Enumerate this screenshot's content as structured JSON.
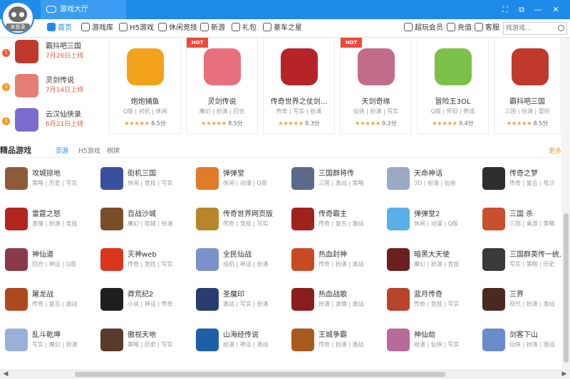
{
  "titlebar": {
    "avatar_badge": "未登录",
    "hall_tab": "游戏大厅",
    "controls": [
      "⛶",
      "⧉",
      "—",
      "✕"
    ]
  },
  "nav": {
    "items": [
      {
        "label": "首页",
        "icon": "home-icon",
        "active": true
      },
      {
        "label": "游戏库",
        "icon": "gamepad-icon",
        "active": false
      },
      {
        "label": "H5游戏",
        "icon": "h5-icon",
        "active": false
      },
      {
        "label": "休闲竞技",
        "icon": "casual-icon",
        "active": false
      },
      {
        "label": "新游",
        "icon": "new-icon",
        "active": false
      },
      {
        "label": "礼包",
        "icon": "gift-icon",
        "active": false
      },
      {
        "label": "豪车之星",
        "icon": "car-icon",
        "active": false
      }
    ],
    "vip": "超玩会员",
    "recharge": "充值",
    "service": "客服",
    "search_placeholder": "找游戏..."
  },
  "new_games": [
    {
      "rank": "1",
      "name": "霸抖吧三国",
      "date": "7月26日上线",
      "color": "#c0392b"
    },
    {
      "rank": "2",
      "name": "灵剑传说",
      "date": "7月14日上线",
      "color": "#e67e73"
    },
    {
      "rank": "3",
      "name": "云汉仙侠录",
      "date": "6月21日上线",
      "color": "#7a6bd1"
    }
  ],
  "featured": [
    {
      "name": "炮炮捕鱼",
      "tags": "Q版 | 对抗 | 休闲",
      "stars": "★★★★★",
      "score": "8.5分",
      "hot": false,
      "color": "#f2a21a"
    },
    {
      "name": "灵剑传说",
      "tags": "魔幻 | 扮演 | 回合",
      "stars": "★★★★★",
      "score": "8.5分",
      "hot": true,
      "color": "#e86f7c"
    },
    {
      "name": "传奇世界之仗剑...",
      "tags": "传奇 | 写实 | 扮演",
      "stars": "★★★★★",
      "score": "9.3分",
      "hot": false,
      "color": "#b6242a"
    },
    {
      "name": "天剑奇缘",
      "tags": "仙侠 | 扮演 | 写实",
      "stars": "★★★★★",
      "score": "9.2分",
      "hot": true,
      "color": "#c06c8a"
    },
    {
      "name": "冒险王3OL",
      "tags": "Q版 | 怀旧 | 养成",
      "stars": "★★★★★",
      "score": "9.4分",
      "hot": false,
      "color": "#7cc04a"
    },
    {
      "name": "霸抖吧三国",
      "tags": "三国 | 扮演 | 冒险",
      "stars": "★★★★★",
      "score": "8.5分",
      "hot": false,
      "color": "#c0392b"
    }
  ],
  "section": {
    "title": "精品游戏",
    "tabs": [
      "页游",
      "H5游戏",
      "棋牌"
    ],
    "more": "更多"
  },
  "games": [
    [
      {
        "name": "攻城掠地",
        "tags": "策略 | 历史 | 写实",
        "color": "#8e5a3a"
      },
      {
        "name": "街机三国",
        "tags": "休闲 | 竞技 | 写实",
        "color": "#3a4f9e"
      },
      {
        "name": "弹弹堂",
        "tags": "休闲 | 动漫 | Q版",
        "color": "#e07b2a"
      },
      {
        "name": "三国群将传",
        "tags": "三国 | 激战 | 策略",
        "color": "#5b6a8a"
      },
      {
        "name": "天命神话",
        "tags": "3D | 扮演 | 仙侠",
        "color": "#9aa9c4"
      },
      {
        "name": "传奇之梦",
        "tags": "传奇 | 复古 | 攻沙",
        "color": "#2e2e2e"
      }
    ],
    [
      {
        "name": "雷霆之怒",
        "tags": "激情 | 扮演 | 竞技",
        "color": "#b3261e"
      },
      {
        "name": "百战沙城",
        "tags": "魔幻 | 攻城 | 扮演",
        "color": "#7a4d2a"
      },
      {
        "name": "传奇世界网页版",
        "tags": "传奇 | 竞技 | 写实",
        "color": "#b8862a"
      },
      {
        "name": "传奇霸主",
        "tags": "传奇 | 复古 | 激战",
        "color": "#a0221e"
      },
      {
        "name": "弹弹堂2",
        "tags": "休闲 | 动漫 | Q版",
        "color": "#58b0e6"
      },
      {
        "name": "三国 杀",
        "tags": "三国 | 桌游 | 策略",
        "color": "#c9502e"
      }
    ],
    [
      {
        "name": "神仙道",
        "tags": "回合 | 神话 | Q版",
        "color": "#8a3a4a"
      },
      {
        "name": "灭神web",
        "tags": "传奇 | 竞技 | 写实",
        "color": "#d8371e"
      },
      {
        "name": "全民仙战",
        "tags": "挂机 | 神话 | 扮演",
        "color": "#7a92c9"
      },
      {
        "name": "热血封神",
        "tags": "传奇 | 扮演 | 激战",
        "color": "#c84a22"
      },
      {
        "name": "暗黑大天使",
        "tags": "魔幻 | 扮演 | 竞技",
        "color": "#6b1f1f"
      },
      {
        "name": "三国群英传一统...",
        "tags": "写实 | 策略 | 历史",
        "color": "#3a3a3a"
      }
    ],
    [
      {
        "name": "屠龙战",
        "tags": "传奇 | 复古 | 激战",
        "color": "#b0481e"
      },
      {
        "name": "莽荒纪2",
        "tags": "小说 | 神话 | 传奇",
        "color": "#1f1f1f"
      },
      {
        "name": "圣魔印",
        "tags": "激战 | 写实 | 扮演",
        "color": "#2b3d6e"
      },
      {
        "name": "热血战歌",
        "tags": "扮演 | 激情 | 激战",
        "color": "#8a1d1d"
      },
      {
        "name": "蓝月传奇",
        "tags": "传奇 | 竞技 | 写实",
        "color": "#b8442a"
      },
      {
        "name": "三界",
        "tags": "现代 | 扮演 | 激战",
        "color": "#4a2a1e"
      }
    ],
    [
      {
        "name": "乱斗乾坤",
        "tags": "写实 | 魔幻 | 扮演",
        "color": "#9ab0d8"
      },
      {
        "name": "傲视天地",
        "tags": "策略 | 历史 | 写实",
        "color": "#5a3a2a"
      },
      {
        "name": "山海经传说",
        "tags": "扮演 | 神话 | 激战",
        "color": "#1f5fa8"
      },
      {
        "name": "王城争霸",
        "tags": "传奇 | 扮演 | 激战",
        "color": "#a85a1e"
      },
      {
        "name": "神仙劫",
        "tags": "扮演 | 仙侠 | 写实",
        "color": "#b86a9a"
      },
      {
        "name": "剑客下山",
        "tags": "仙侠 | 扮演 | 激战",
        "color": "#6a8ac9"
      }
    ]
  ]
}
